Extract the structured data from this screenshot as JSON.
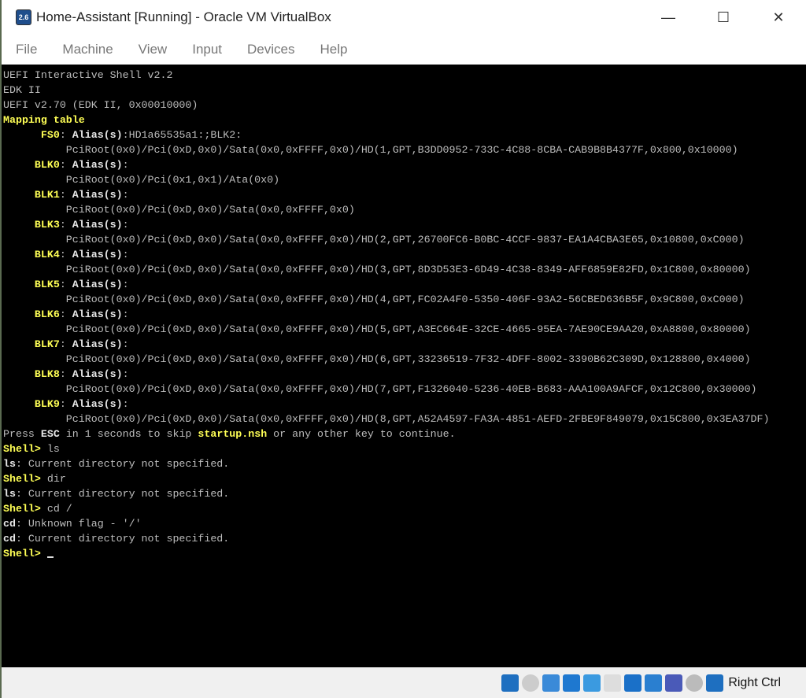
{
  "window": {
    "title": "Home-Assistant [Running] - Oracle VM VirtualBox",
    "app_icon_text": "2.6",
    "minimize": "—",
    "maximize": "☐",
    "close": "✕"
  },
  "menu": [
    "File",
    "Machine",
    "View",
    "Input",
    "Devices",
    "Help"
  ],
  "terminal": {
    "lines": [
      [
        {
          "t": "UEFI Interactive Shell v2.2",
          "c": "w"
        }
      ],
      [
        {
          "t": "EDK II",
          "c": "w"
        }
      ],
      [
        {
          "t": "UEFI v2.70 (EDK II, 0x00010000)",
          "c": "w"
        }
      ],
      [
        {
          "t": "Mapping table",
          "c": "y"
        }
      ],
      [
        {
          "t": "      FS0",
          "c": "y"
        },
        {
          "t": ": ",
          "c": "w"
        },
        {
          "t": "Alias(s)",
          "c": "b"
        },
        {
          "t": ":HD1a65535a1:;BLK2:",
          "c": "w"
        }
      ],
      [
        {
          "t": "          PciRoot(0x0)/Pci(0xD,0x0)/Sata(0x0,0xFFFF,0x0)/HD(1,GPT,B3DD0952-733C-4C88-8CBA-CAB9B8B4377F,0x800,0x10000)",
          "c": "w"
        }
      ],
      [
        {
          "t": "     BLK0",
          "c": "y"
        },
        {
          "t": ": ",
          "c": "w"
        },
        {
          "t": "Alias(s)",
          "c": "b"
        },
        {
          "t": ":",
          "c": "w"
        }
      ],
      [
        {
          "t": "          PciRoot(0x0)/Pci(0x1,0x1)/Ata(0x0)",
          "c": "w"
        }
      ],
      [
        {
          "t": "     BLK1",
          "c": "y"
        },
        {
          "t": ": ",
          "c": "w"
        },
        {
          "t": "Alias(s)",
          "c": "b"
        },
        {
          "t": ":",
          "c": "w"
        }
      ],
      [
        {
          "t": "          PciRoot(0x0)/Pci(0xD,0x0)/Sata(0x0,0xFFFF,0x0)",
          "c": "w"
        }
      ],
      [
        {
          "t": "     BLK3",
          "c": "y"
        },
        {
          "t": ": ",
          "c": "w"
        },
        {
          "t": "Alias(s)",
          "c": "b"
        },
        {
          "t": ":",
          "c": "w"
        }
      ],
      [
        {
          "t": "          PciRoot(0x0)/Pci(0xD,0x0)/Sata(0x0,0xFFFF,0x0)/HD(2,GPT,26700FC6-B0BC-4CCF-9837-EA1A4CBA3E65,0x10800,0xC000)",
          "c": "w"
        }
      ],
      [
        {
          "t": "     BLK4",
          "c": "y"
        },
        {
          "t": ": ",
          "c": "w"
        },
        {
          "t": "Alias(s)",
          "c": "b"
        },
        {
          "t": ":",
          "c": "w"
        }
      ],
      [
        {
          "t": "          PciRoot(0x0)/Pci(0xD,0x0)/Sata(0x0,0xFFFF,0x0)/HD(3,GPT,8D3D53E3-6D49-4C38-8349-AFF6859E82FD,0x1C800,0x80000)",
          "c": "w"
        }
      ],
      [
        {
          "t": "     BLK5",
          "c": "y"
        },
        {
          "t": ": ",
          "c": "w"
        },
        {
          "t": "Alias(s)",
          "c": "b"
        },
        {
          "t": ":",
          "c": "w"
        }
      ],
      [
        {
          "t": "          PciRoot(0x0)/Pci(0xD,0x0)/Sata(0x0,0xFFFF,0x0)/HD(4,GPT,FC02A4F0-5350-406F-93A2-56CBED636B5F,0x9C800,0xC000)",
          "c": "w"
        }
      ],
      [
        {
          "t": "     BLK6",
          "c": "y"
        },
        {
          "t": ": ",
          "c": "w"
        },
        {
          "t": "Alias(s)",
          "c": "b"
        },
        {
          "t": ":",
          "c": "w"
        }
      ],
      [
        {
          "t": "          PciRoot(0x0)/Pci(0xD,0x0)/Sata(0x0,0xFFFF,0x0)/HD(5,GPT,A3EC664E-32CE-4665-95EA-7AE90CE9AA20,0xA8800,0x80000)",
          "c": "w"
        }
      ],
      [
        {
          "t": "     BLK7",
          "c": "y"
        },
        {
          "t": ": ",
          "c": "w"
        },
        {
          "t": "Alias(s)",
          "c": "b"
        },
        {
          "t": ":",
          "c": "w"
        }
      ],
      [
        {
          "t": "          PciRoot(0x0)/Pci(0xD,0x0)/Sata(0x0,0xFFFF,0x0)/HD(6,GPT,33236519-7F32-4DFF-8002-3390B62C309D,0x128800,0x4000)",
          "c": "w"
        }
      ],
      [
        {
          "t": "     BLK8",
          "c": "y"
        },
        {
          "t": ": ",
          "c": "w"
        },
        {
          "t": "Alias(s)",
          "c": "b"
        },
        {
          "t": ":",
          "c": "w"
        }
      ],
      [
        {
          "t": "          PciRoot(0x0)/Pci(0xD,0x0)/Sata(0x0,0xFFFF,0x0)/HD(7,GPT,F1326040-5236-40EB-B683-AAA100A9AFCF,0x12C800,0x30000)",
          "c": "w"
        }
      ],
      [
        {
          "t": "     BLK9",
          "c": "y"
        },
        {
          "t": ": ",
          "c": "w"
        },
        {
          "t": "Alias(s)",
          "c": "b"
        },
        {
          "t": ":",
          "c": "w"
        }
      ],
      [
        {
          "t": "          PciRoot(0x0)/Pci(0xD,0x0)/Sata(0x0,0xFFFF,0x0)/HD(8,GPT,A52A4597-FA3A-4851-AEFD-2FBE9F849079,0x15C800,0x3EA37DF)",
          "c": "w"
        }
      ],
      [
        {
          "t": "Press ",
          "c": "w"
        },
        {
          "t": "ESC",
          "c": "b"
        },
        {
          "t": " in 1 seconds to skip ",
          "c": "w"
        },
        {
          "t": "startup.nsh",
          "c": "y"
        },
        {
          "t": " or any other key to continue.",
          "c": "w"
        }
      ],
      [
        {
          "t": "Shell> ",
          "c": "y"
        },
        {
          "t": "ls",
          "c": "w"
        }
      ],
      [
        {
          "t": "ls",
          "c": "b"
        },
        {
          "t": ": Current directory not specified.",
          "c": "w"
        }
      ],
      [
        {
          "t": "Shell> ",
          "c": "y"
        },
        {
          "t": "dir",
          "c": "w"
        }
      ],
      [
        {
          "t": "ls",
          "c": "b"
        },
        {
          "t": ": Current directory not specified.",
          "c": "w"
        }
      ],
      [
        {
          "t": "Shell> ",
          "c": "y"
        },
        {
          "t": "cd /",
          "c": "w"
        }
      ],
      [
        {
          "t": "cd",
          "c": "b"
        },
        {
          "t": ": Unknown flag - '/'",
          "c": "w"
        }
      ],
      [
        {
          "t": "cd",
          "c": "b"
        },
        {
          "t": ": Current directory not specified.",
          "c": "w"
        }
      ],
      [
        {
          "t": "Shell> ",
          "c": "y"
        }
      ]
    ]
  },
  "statusbar": {
    "icons": [
      "hard-disk-icon",
      "optical-drive-icon",
      "audio-icon",
      "network-icon",
      "usb-icon",
      "shared-folders-icon",
      "display-icon",
      "video-capture-icon",
      "virtualization-icon",
      "mouse-integration-icon",
      "host-key-icon"
    ],
    "host_key": "Right Ctrl"
  }
}
